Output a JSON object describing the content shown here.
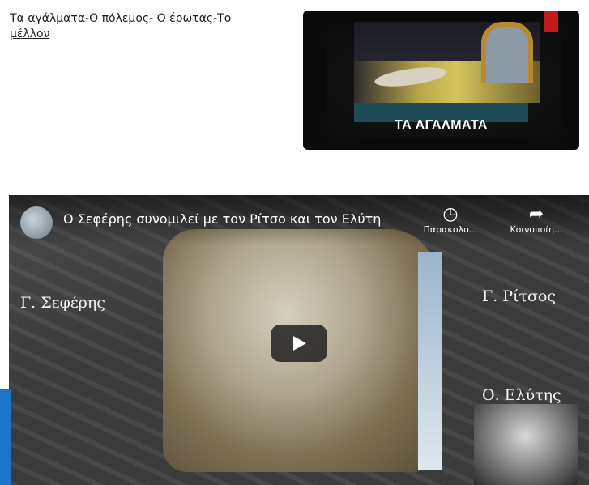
{
  "top_link": {
    "text": "Τα αγάλματα-Ο πόλεμος- Ο έρωτας-Το μέλλον"
  },
  "thumbnail": {
    "title": "ΤΑ ΑΓΑΛΜΑΤΑ"
  },
  "video": {
    "title": "Ο Σεφέρης συνομιλεί με τον Ρίτσο και τον Ελύτη",
    "actions": [
      {
        "label": "Παρακολο...",
        "icon": "clock-icon"
      },
      {
        "label": "Κοινοποίη...",
        "icon": "share-icon"
      }
    ],
    "names": {
      "left": "Γ. Σεφέρης",
      "right_top": "Γ. Ρίτσος",
      "right_bottom": "Ο. Ελύτης"
    }
  }
}
